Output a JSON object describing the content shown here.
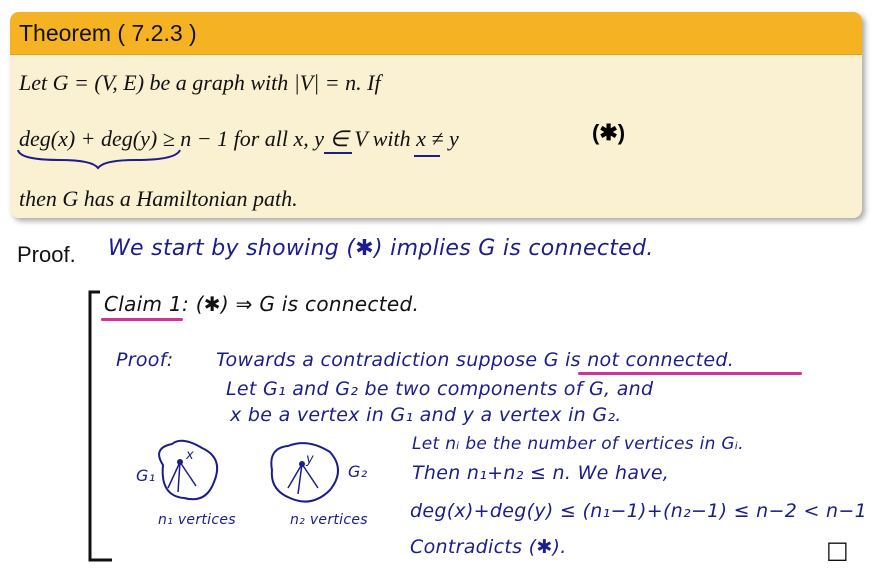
{
  "theorem": {
    "title": "Theorem ( 7.2.3 )",
    "line1": "Let G = (V, E) be a graph with |V| = n. If",
    "line2": "deg(x) + deg(y) ≥ n − 1  for all x, y ∈ V with x ≠ y",
    "star": "(✱)",
    "line3": "then G has a Hamiltonian path."
  },
  "proof_label": "Proof.",
  "handwriting": {
    "intro": "We start by showing (✱) implies G is connected.",
    "claim": "Claim 1:  (✱) ⇒ G is connected.",
    "proof_head": "Proof:",
    "l1": "Towards a contradiction suppose G is not connected.",
    "l2": "Let G₁ and G₂ be two components of G, and",
    "l3": "x be a vertex in G₁ and y a vertex in G₂.",
    "l4": "Let nᵢ be the number of vertices in Gᵢ.",
    "l5": "Then n₁+n₂ ≤ n. We have,",
    "l6": "deg(x)+deg(y) ≤ (n₁−1)+(n₂−1) ≤ n−2 < n−1",
    "l7": "Contradicts (✱).",
    "g1": "G₁",
    "g2": "G₂",
    "g1_node": "x",
    "g2_node": "y",
    "n1_caption": "n₁ vertices",
    "n2_caption": "n₂ vertices",
    "qed": "□"
  }
}
